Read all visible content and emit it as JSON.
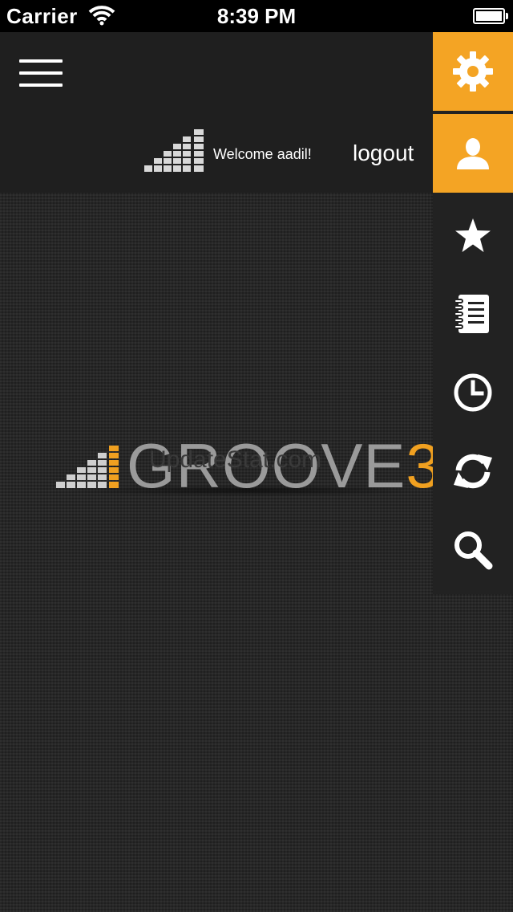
{
  "status_bar": {
    "carrier": "Carrier",
    "time": "8:39 PM"
  },
  "header": {
    "menu_icon": "hamburger-icon",
    "welcome_text": "Welcome aadil!",
    "logout_label": "logout"
  },
  "logo": {
    "brand_text": "GROOVE",
    "brand_number": "3",
    "overlay_text": "UpdateStat.com"
  },
  "side_menu": {
    "items": [
      {
        "icon": "gear-icon",
        "active": true
      },
      {
        "icon": "user-icon",
        "active": true
      },
      {
        "icon": "star-icon",
        "active": false
      },
      {
        "icon": "notebook-icon",
        "active": false
      },
      {
        "icon": "clock-icon",
        "active": false
      },
      {
        "icon": "refresh-icon",
        "active": false
      },
      {
        "icon": "search-icon",
        "active": false
      }
    ]
  },
  "colors": {
    "accent": "#f4a424",
    "background": "#1c1c1c",
    "text": "#ffffff"
  }
}
